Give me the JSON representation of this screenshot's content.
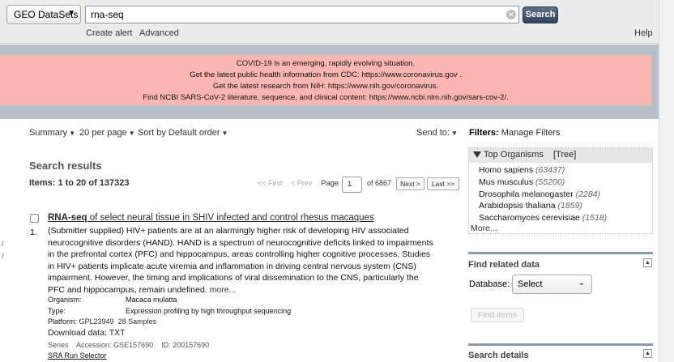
{
  "topbar": {
    "db_select": "GEO DataSets",
    "search_value": "rna-seq",
    "search_btn": "Search",
    "create_alert": "Create alert",
    "advanced": "Advanced",
    "help": "Help"
  },
  "covid": {
    "line1": "COVID-19 is an emerging, rapidly evolving situation.",
    "line2_prefix": "Get the latest public health information from CDC: ",
    "line2_link": "https://www.coronavirus.gov",
    "line2_suffix": " .",
    "line3_prefix": "Get the latest research from NIH: ",
    "line3_link": "https://www.nih.gov/coronavirus",
    "line3_suffix": ".",
    "line4_prefix": "Find NCBI SARS-CoV-2 literature, sequence, and clinical content: ",
    "line4_link": "https://www.ncbi.nlm.nih.gov/sars-cov-2/",
    "line4_suffix": "."
  },
  "controls": {
    "summary": "Summary",
    "per_page": "20 per page",
    "sort": "Sort by Default order",
    "send_to": "Send to:"
  },
  "results": {
    "heading": "Search results",
    "items": "Items: 1 to 20 of 137323"
  },
  "pager": {
    "first": "<< First",
    "prev": "< Prev",
    "page_label": "Page",
    "page_value": "1",
    "of": "of 6867",
    "next": "Next >",
    "last": "Last >>"
  },
  "result1": {
    "number": "1.",
    "title_bold": "RNA-seq",
    "title_rest": " of select neural tissue in SHIV infected and control rhesus macaques",
    "desc": "(Submitter supplied) HIV+ patients are at an alarmingly higher risk of developing HIV associated neurocognitive disorders (HAND). HAND is a spectrum of neurocognitive deficits linked to impairments in the prefrontal cortex (PFC) and hippocampus, areas controlling higher cognitive processes. Studies in HIV+ patients implicate acute viremia and inflammation in driving central nervous system (CNS) impairment. However, the timing and implications of viral dissemination to the CNS, particularly the PFC and hippocampus, remain undefined.",
    "more": "more...",
    "organism_label": "Organism:",
    "organism_value": "Macaca mulatta",
    "type_label": "Type:",
    "type_value": "Expression profiling by high throughput sequencing",
    "platform_label": "Platform:",
    "platform_value": "GPL23949",
    "samples": "28 Samples",
    "download": "Download data: TXT",
    "series": "Series",
    "accession": "Accession: GSE157690",
    "id": "ID: 200157690",
    "sra": "SRA Run Selector"
  },
  "sidebar": {
    "filters_label": "Filters:",
    "manage_filters": "Manage Filters",
    "top_organisms": "Top Organisms",
    "tree": "[Tree]",
    "organisms": [
      {
        "name": "Homo sapiens",
        "count": "(63437)"
      },
      {
        "name": "Mus musculus",
        "count": "(55200)"
      },
      {
        "name": "Drosophila melanogaster",
        "count": "(2284)"
      },
      {
        "name": "Arabidopsis thaliana",
        "count": "(1859)"
      },
      {
        "name": "Saccharomyces cerevisiae",
        "count": "(1518)"
      }
    ],
    "more": "More...",
    "find_related": "Find related data",
    "database_label": "Database:",
    "database_value": "Select",
    "find_items": "Find items",
    "search_details": "Search details"
  },
  "left_edge_marks": [
    "/",
    "/"
  ]
}
